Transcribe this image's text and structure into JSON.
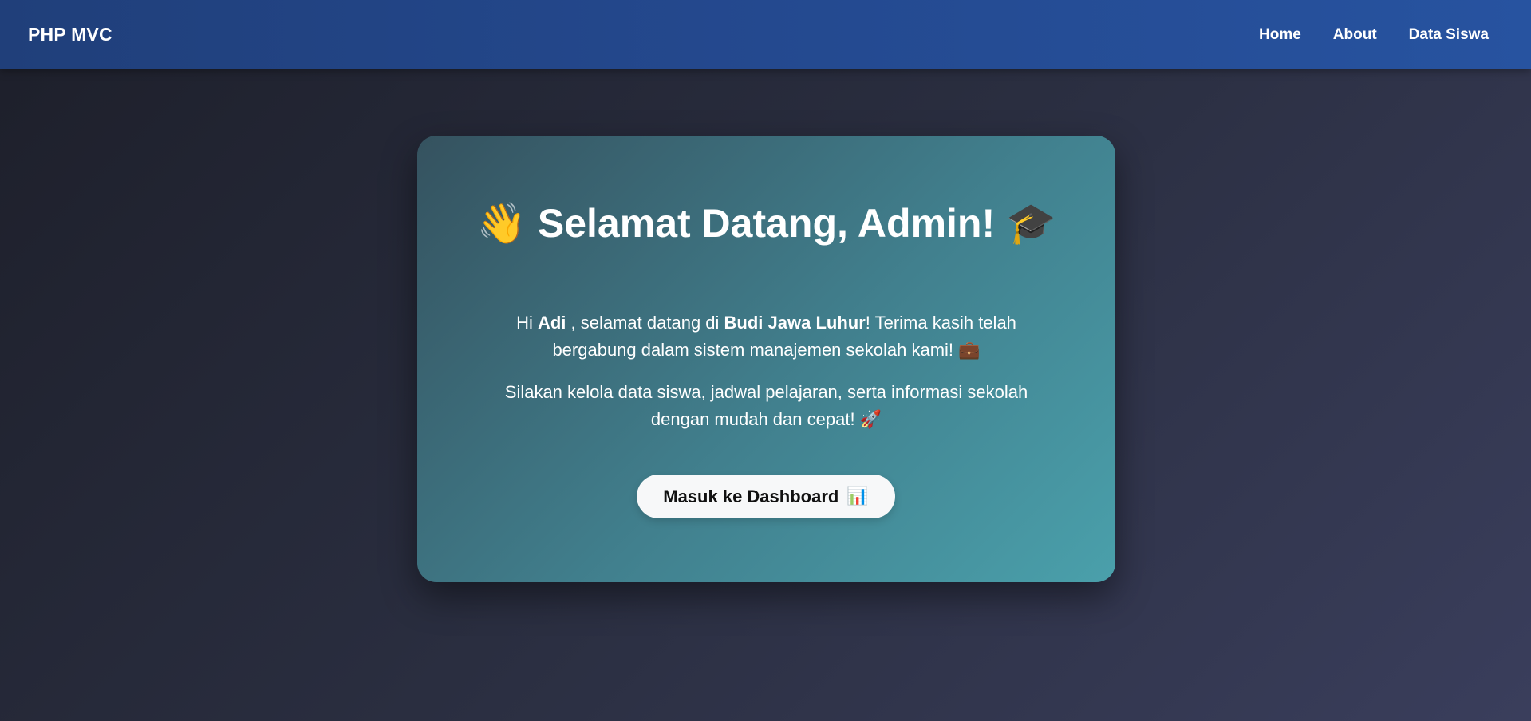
{
  "navbar": {
    "brand": "PHP MVC",
    "links": [
      {
        "label": "Home"
      },
      {
        "label": "About"
      },
      {
        "label": "Data Siswa"
      }
    ]
  },
  "welcome": {
    "title_emoji_left": "👋",
    "title": "Selamat Datang, Admin!",
    "title_emoji_right": "🎓",
    "greeting_prefix": "Hi ",
    "user_name": "Adi",
    "greeting_middle": " , selamat datang di ",
    "school_name": "Budi Jawa Luhur",
    "greeting_suffix": "! Terima kasih telah bergabung dalam sistem manajemen sekolah kami! ",
    "greeting_emoji": "💼",
    "description": "Silakan kelola data siswa, jadwal pelajaran, serta informasi sekolah dengan mudah dan cepat! ",
    "description_emoji": "🚀",
    "button_label": "Masuk ke Dashboard",
    "button_emoji": "📊"
  },
  "icons": {
    "wave": "waving-hand-icon",
    "graduation": "graduation-cap-icon",
    "briefcase": "briefcase-icon",
    "rocket": "rocket-icon",
    "chart": "bar-chart-icon"
  },
  "colors": {
    "navbar": "#24498f",
    "card_start": "#35525f",
    "card_end": "#4aa0ab",
    "button_bg": "#f7f8f9",
    "button_text": "#111111",
    "text": "#ffffff"
  }
}
